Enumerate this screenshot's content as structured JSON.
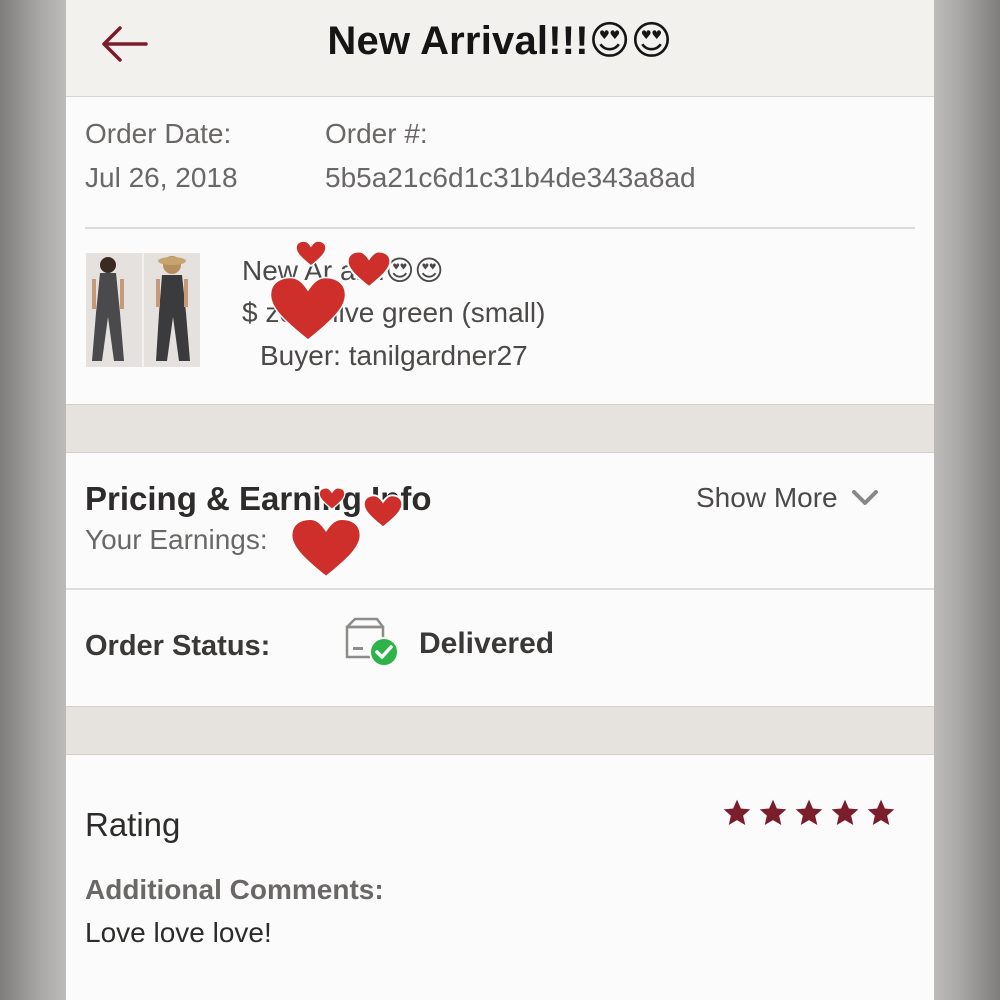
{
  "header": {
    "title": "New Arrival!!!😍😍",
    "back_icon": "arrow-left-icon"
  },
  "order": {
    "date_label": "Order Date:",
    "date_value": "Jul 26, 2018",
    "number_label": "Order #:",
    "number_value": "5b5a21c6d1c31b4de343a8ad"
  },
  "item": {
    "title": "New Ar   al!!!😍😍",
    "detail": "$        ze: Olive green (small)",
    "buyer": "Buyer: tanilgardner27"
  },
  "pricing": {
    "title": "Pricing & Earning Info",
    "subtitle": "Your Earnings:",
    "show_more": "Show More",
    "chevron_icon": "chevron-down-icon"
  },
  "status": {
    "label": "Order Status:",
    "value": "Delivered",
    "icon": "delivered-box-icon"
  },
  "rating": {
    "label": "Rating",
    "stars": 5,
    "comments_label": "Additional Comments:",
    "comments_text": "Love love love!"
  },
  "colors": {
    "accent": "#7a1e2b",
    "success": "#2db34a",
    "sticker_heart": "#cf2f2b"
  }
}
